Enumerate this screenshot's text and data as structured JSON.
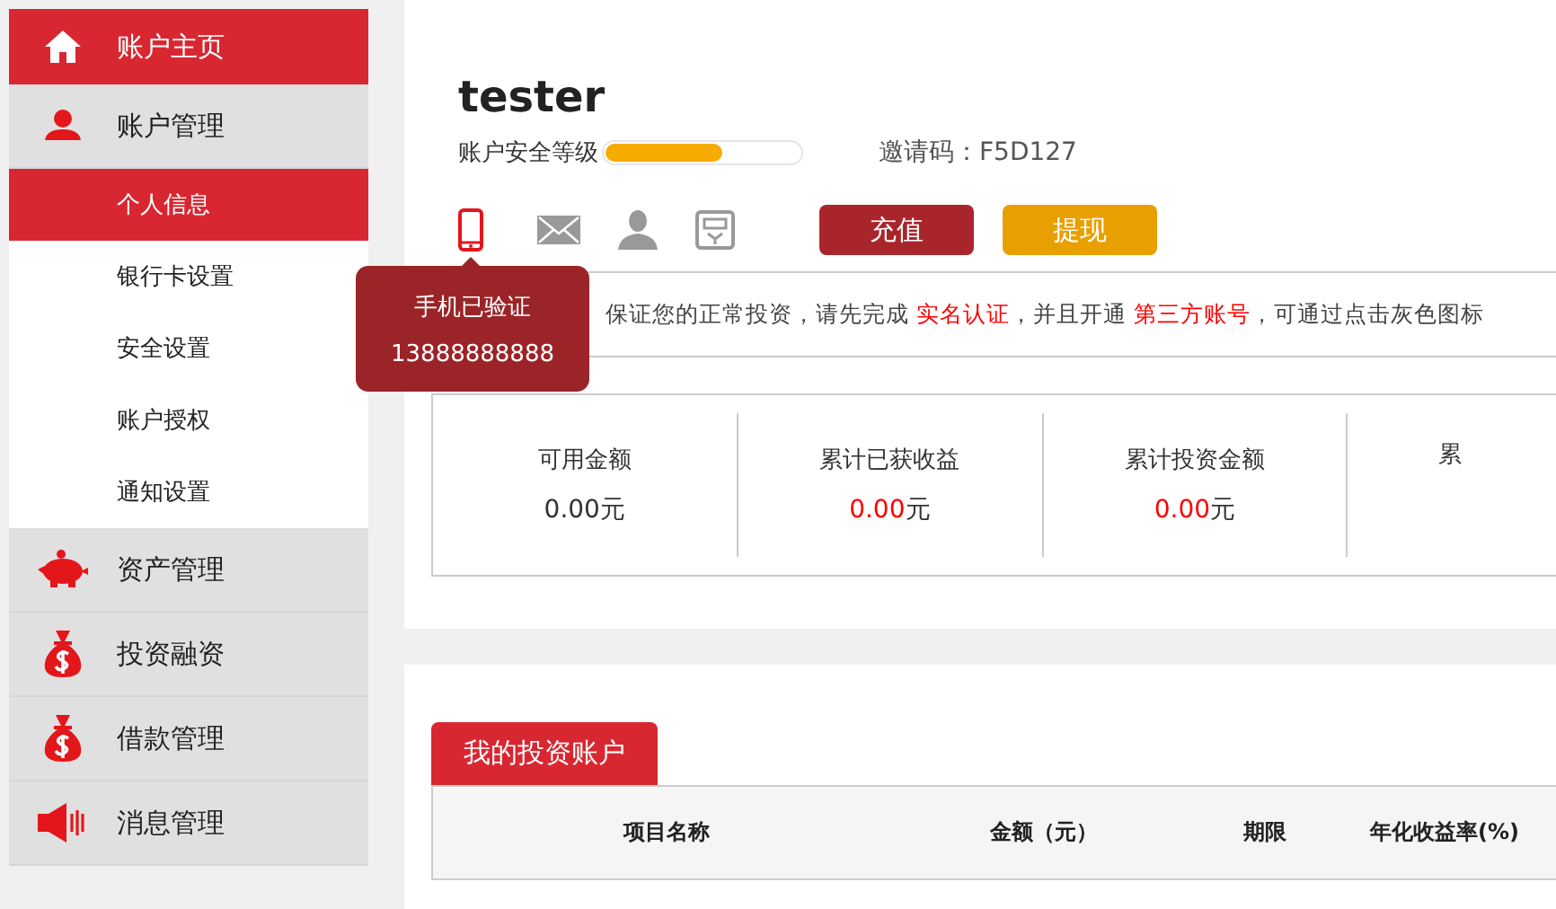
{
  "sidebar": {
    "items": [
      {
        "label": "账户主页",
        "kind": "home",
        "selected": true
      },
      {
        "label": "账户管理",
        "kind": "person",
        "selected": false,
        "expanded": true,
        "children": [
          {
            "label": "个人信息",
            "selected": true
          },
          {
            "label": "银行卡设置",
            "selected": false
          },
          {
            "label": "安全设置",
            "selected": false
          },
          {
            "label": "账户授权",
            "selected": false
          },
          {
            "label": "通知设置",
            "selected": false
          }
        ]
      },
      {
        "label": "资产管理",
        "kind": "piggy",
        "selected": false
      },
      {
        "label": "投资融资",
        "kind": "bag",
        "selected": false
      },
      {
        "label": "借款管理",
        "kind": "bag",
        "selected": false
      },
      {
        "label": "消息管理",
        "kind": "speaker",
        "selected": false
      }
    ]
  },
  "profile": {
    "username": "tester",
    "security_label": "账户安全等级",
    "security": {
      "level": 0.6
    },
    "invite_code": "邀请码：F5D127",
    "verifications": [
      {
        "kind": "phone",
        "verified": true
      },
      {
        "kind": "mail",
        "verified": false
      },
      {
        "kind": "person",
        "verified": false
      },
      {
        "kind": "id",
        "verified": false
      }
    ],
    "buttons": [
      {
        "label": "充值",
        "kind": "recharge"
      },
      {
        "label": "提现",
        "kind": "withdraw"
      }
    ],
    "tooltip": {
      "title": "手机已验证",
      "phone": "13888888888"
    },
    "notice": [
      {
        "text": "保证您的正常投资，请先完成 ",
        "highlight": false
      },
      {
        "text": "实名认证",
        "highlight": true
      },
      {
        "text": "，并且开通 ",
        "highlight": false
      },
      {
        "text": "第三方账号",
        "highlight": true
      },
      {
        "text": "，可通过点击灰色图标",
        "highlight": false
      }
    ],
    "stats": [
      {
        "label": "可用金额",
        "value": "0.00",
        "unit": "元",
        "highlight": false
      },
      {
        "label": "累计已获收益",
        "value": "0.00",
        "unit": "元",
        "highlight": true
      },
      {
        "label": "累计投资金额",
        "value": "0.00",
        "unit": "元",
        "highlight": true
      },
      {
        "label": "累"
      }
    ]
  },
  "investments": {
    "tab": "我的投资账户",
    "columns": [
      "项目名称",
      "金额（元）",
      "期限",
      "年化收益率(%)"
    ]
  }
}
